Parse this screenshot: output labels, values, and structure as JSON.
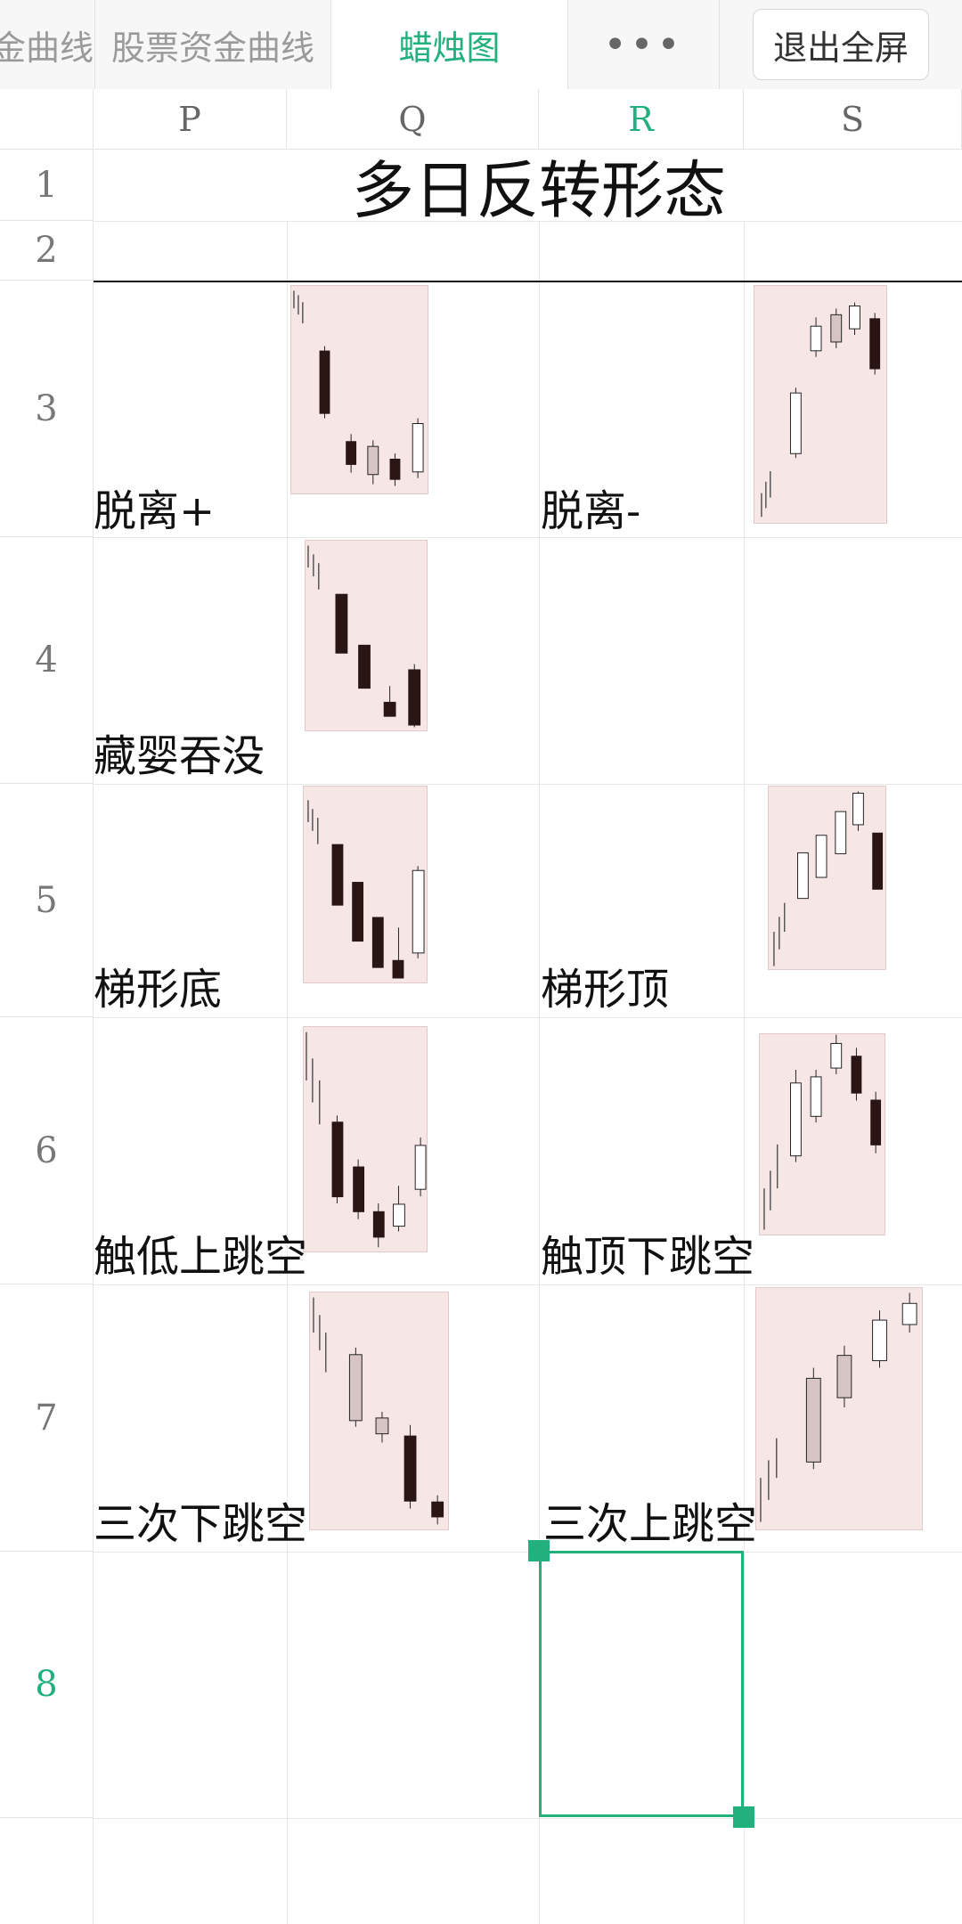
{
  "tabs": [
    {
      "label": "金曲线"
    },
    {
      "label": "股票资金曲线"
    },
    {
      "label": "蜡烛图"
    },
    {
      "label": "•••"
    }
  ],
  "exit_button": "退出全屏",
  "columns": [
    "P",
    "Q",
    "R",
    "S"
  ],
  "rows": [
    "1",
    "2",
    "3",
    "4",
    "5",
    "6",
    "7",
    "8"
  ],
  "sheet_title": "多日反转形态",
  "patterns": {
    "r3_left": "脱离+",
    "r3_right": "脱离-",
    "r4_left": "藏婴吞没",
    "r5_left": "梯形底",
    "r5_right": "梯形顶",
    "r6_left": "触低上跳空",
    "r6_right": "触顶下跳空",
    "r7_left": "三次下跳空",
    "r7_right": "三次上跳空"
  },
  "accent_color": "#22b07d",
  "selected_cell": "R8"
}
